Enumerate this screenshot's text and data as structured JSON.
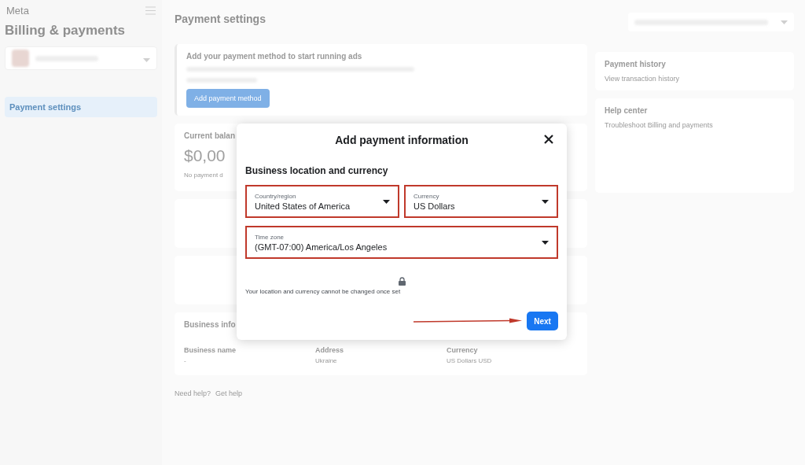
{
  "sidebar": {
    "logo": "Meta",
    "title": "Billing & payments",
    "items": [
      {
        "label": "Payment settings",
        "selected": true
      }
    ]
  },
  "main": {
    "title": "Payment settings",
    "alert": {
      "title": "Add your payment method to start running ads",
      "button": "Add payment method"
    },
    "balance": {
      "title": "Current balan",
      "amount": "$0,00",
      "note": "No payment d"
    },
    "business_info": {
      "title": "Business info",
      "fields": [
        {
          "label": "Business name",
          "value": "-"
        },
        {
          "label": "Address",
          "value": "Ukraine"
        },
        {
          "label": "Currency",
          "value": "US Dollars USD"
        }
      ]
    },
    "help": {
      "text": "Need help?",
      "link": "Get help"
    }
  },
  "right": {
    "payment_history": {
      "title": "Payment history",
      "link": "View transaction history"
    },
    "help_center": {
      "title": "Help center",
      "link": "Troubleshoot Billing and payments"
    }
  },
  "modal": {
    "title": "Add payment information",
    "section": "Business location and currency",
    "fields": [
      {
        "label": "Country/region",
        "value": "United States of America",
        "highlighted": true
      },
      {
        "label": "Currency",
        "value": "US Dollars",
        "highlighted": true
      },
      {
        "label": "Time zone",
        "value": "(GMT-07:00) America/Los Angeles",
        "highlighted": true
      }
    ],
    "note": "Your location and currency cannot be changed once set",
    "button": "Next",
    "arrow": true
  }
}
